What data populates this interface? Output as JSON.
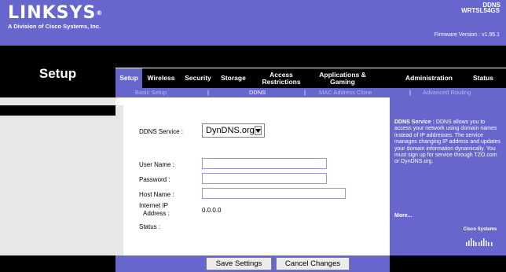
{
  "brand": {
    "logo": "LINKSYS",
    "registered": "®",
    "subtitle": "A Division of Cisco Systems, Inc."
  },
  "firmware": {
    "label": "Firmware Version",
    "value": ": v1.95.1"
  },
  "model": "WRTSL54GS",
  "page_title": "Setup",
  "main_nav": [
    {
      "label": "Setup",
      "active": true
    },
    {
      "label": "Wireless"
    },
    {
      "label": "Security"
    },
    {
      "label": "Storage"
    },
    {
      "label": "Access Restrictions"
    },
    {
      "label": "Applications & Gaming"
    },
    {
      "label": "Administration"
    },
    {
      "label": "Status"
    }
  ],
  "sub_nav": [
    {
      "label": "Basic Setup"
    },
    {
      "label": "DDNS",
      "active": true
    },
    {
      "label": "MAC Address Clone"
    },
    {
      "label": "Advanced Routing"
    }
  ],
  "section_label": "DDNS",
  "form": {
    "ddns_service_label": "DDNS Service :",
    "ddns_service_value": "DynDNS.org",
    "username_label": "User Name :",
    "username_value": "",
    "password_label": "Password :",
    "password_value": "",
    "hostname_label": "Host Name :",
    "hostname_value": "",
    "internet_ip_label_1": "Internet IP",
    "internet_ip_label_2": "Address :",
    "internet_ip_value": "0.0.0.0",
    "status_label": "Status :"
  },
  "help": {
    "title": "DDNS Service :",
    "body": "DDNS allows you to access your network using domain names instead of IP addresses. The service manages changing IP address and updates your domain information dynamically. You must sign up for service through TZO.com or DynDNS.org.",
    "more": "More..."
  },
  "cisco": "Cisco Systems",
  "buttons": {
    "save": "Save Settings",
    "cancel": "Cancel Changes"
  },
  "colors": {
    "accent": "#6666cc",
    "dark": "#000000",
    "panel": "#e7e7e7"
  }
}
